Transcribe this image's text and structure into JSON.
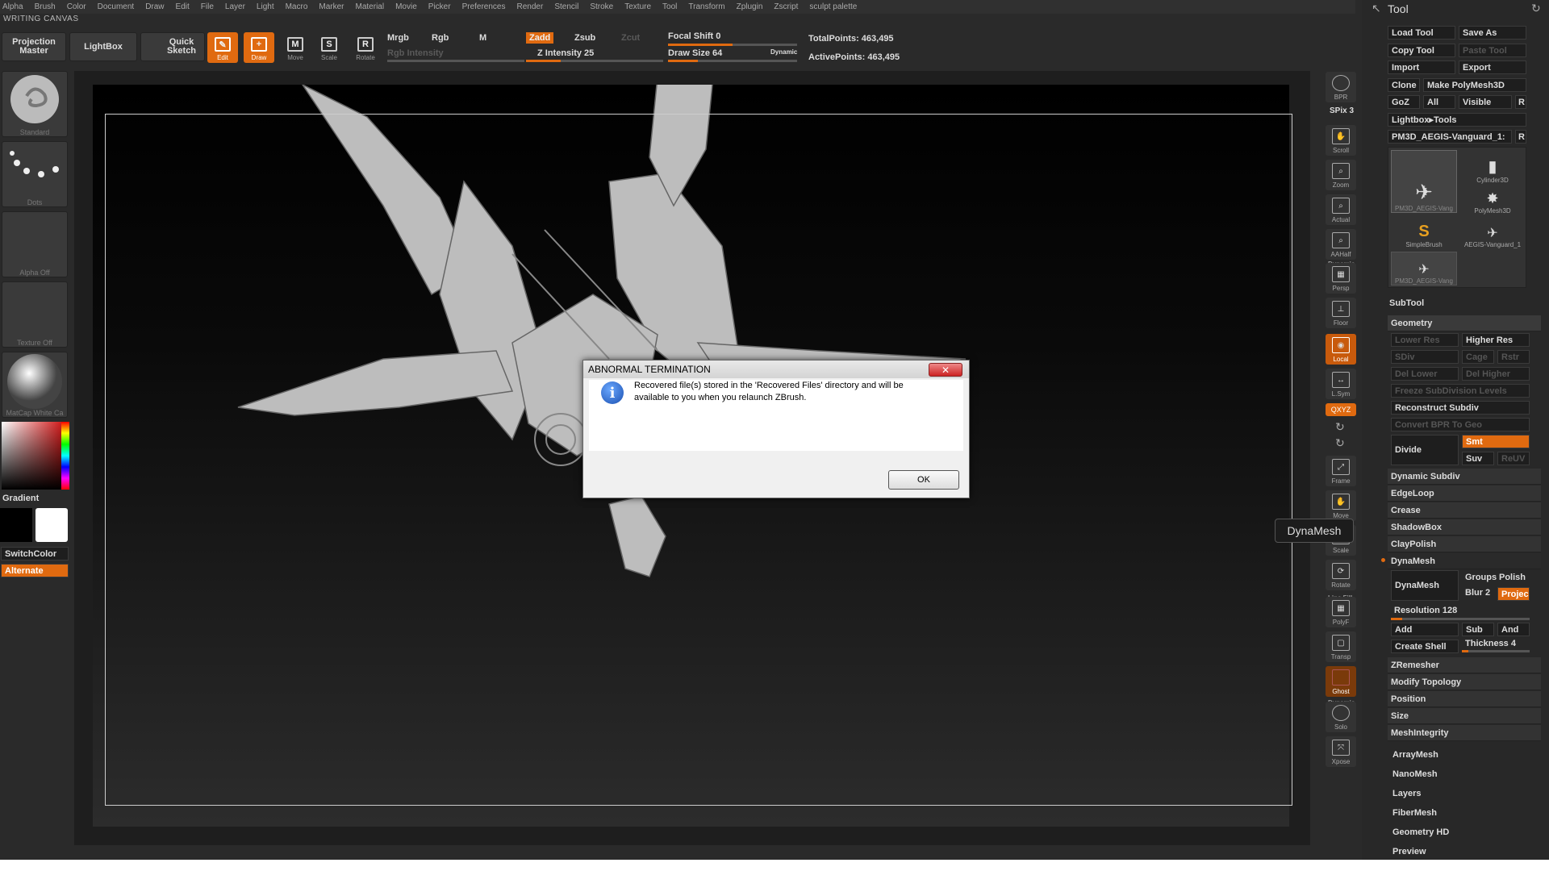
{
  "menu": [
    "Alpha",
    "Brush",
    "Color",
    "Document",
    "Draw",
    "Edit",
    "File",
    "Layer",
    "Light",
    "Macro",
    "Marker",
    "Material",
    "Movie",
    "Picker",
    "Preferences",
    "Render",
    "Stencil",
    "Stroke",
    "Texture",
    "Tool",
    "Transform",
    "Zplugin",
    "Zscript",
    "sculpt palette"
  ],
  "doc_title": "WRITING CANVAS",
  "toolbar": {
    "projection_master": "Projection Master",
    "lightbox": "LightBox",
    "quick_sketch": "Quick Sketch",
    "edit": "Edit",
    "draw": "Draw",
    "move": "Move",
    "scale": "Scale",
    "rotate": "Rotate",
    "mrgb": "Mrgb",
    "rgb": "Rgb",
    "m": "M",
    "rgb_intensity": "Rgb Intensity",
    "zadd": "Zadd",
    "zsub": "Zsub",
    "zcut": "Zcut",
    "z_intensity": "Z Intensity 25",
    "focal_shift": "Focal Shift 0",
    "draw_size": "Draw Size 64",
    "dynamic": "Dynamic",
    "total_points": "TotalPoints: 463,495",
    "active_points": "ActivePoints: 463,495"
  },
  "left_shelf": {
    "brush": "Standard",
    "stroke": "Dots",
    "alpha": "Alpha Off",
    "texture": "Texture Off",
    "material": "MatCap White Ca",
    "gradient": "Gradient",
    "switch_color": "SwitchColor",
    "alternate": "Alternate"
  },
  "right_shelf": {
    "bpr": "BPR",
    "spix": "SPix 3",
    "scroll": "Scroll",
    "zoom": "Zoom",
    "actual": "Actual",
    "aahalf": "AAHalf",
    "dynamic": "Dynamic",
    "persp": "Persp",
    "floor": "Floor",
    "local": "Local",
    "lsym": "L.Sym",
    "xyz": "QXYZ",
    "frame": "Frame",
    "move": "Move",
    "scale": "Scale",
    "rotate": "Rotate",
    "line_fill": "Line Fill",
    "polyf": "PolyF",
    "transp": "Transp",
    "ghost": "Ghost",
    "dynamic2": "Dynamic",
    "solo": "Solo",
    "xpose": "Xpose"
  },
  "tooltip": "DynaMesh",
  "tool_panel": {
    "title": "Tool",
    "load_tool": "Load Tool",
    "save_as": "Save As",
    "copy_tool": "Copy Tool",
    "paste_tool": "Paste Tool",
    "import": "Import",
    "export": "Export",
    "clone": "Clone",
    "make_polymesh": "Make PolyMesh3D",
    "goz": "GoZ",
    "all": "All",
    "visible": "Visible",
    "r": "R",
    "lightbox_tools": "Lightbox▸Tools",
    "current_tool": "PM3D_AEGIS-Vanguard_1:",
    "tools": [
      "PM3D_AEGIS-Vang",
      "Cylinder3D",
      "PolyMesh3D",
      "SimpleBrush",
      "AEGIS-Vanguard_1",
      "PM3D_AEGIS-Vang"
    ],
    "subtool": "SubTool",
    "geometry": "Geometry",
    "lower_res": "Lower Res",
    "higher_res": "Higher Res",
    "sdiv": "SDiv",
    "cage": "Cage",
    "rstr": "Rstr",
    "del_lower": "Del Lower",
    "del_higher": "Del Higher",
    "freeze": "Freeze SubDivision Levels",
    "reconstruct": "Reconstruct Subdiv",
    "convert_bpr": "Convert BPR To Geo",
    "divide": "Divide",
    "smt": "Smt",
    "suv": "Suv",
    "reuv": "ReUV",
    "dynamic_subdiv": "Dynamic Subdiv",
    "edgeloop": "EdgeLoop",
    "crease": "Crease",
    "shadowbox": "ShadowBox",
    "claypolish": "ClayPolish",
    "dynamesh_hdr": "DynaMesh",
    "dynamesh_btn": "DynaMesh",
    "groups": "Groups",
    "polish": "Polish",
    "blur": "Blur 2",
    "project": "Projec",
    "resolution": "Resolution 128",
    "add": "Add",
    "sub": "Sub",
    "and": "And",
    "create_shell": "Create Shell",
    "thickness": "Thickness 4",
    "zremesher": "ZRemesher",
    "modify_topology": "Modify Topology",
    "position": "Position",
    "size": "Size",
    "meshintegrity": "MeshIntegrity",
    "arraymesh": "ArrayMesh",
    "nanomesh": "NanoMesh",
    "layers": "Layers",
    "fibermesh": "FiberMesh",
    "geometry_hd": "Geometry HD",
    "preview": "Preview"
  },
  "dialog": {
    "title": "ABNORMAL TERMINATION",
    "close": "✕",
    "message": "Recovered file(s) stored in the 'Recovered Files' directory and will be available to you when you relaunch ZBrush.",
    "ok": "OK"
  },
  "colors": {
    "accent": "#e06a10",
    "background": "#2a2a2a"
  }
}
